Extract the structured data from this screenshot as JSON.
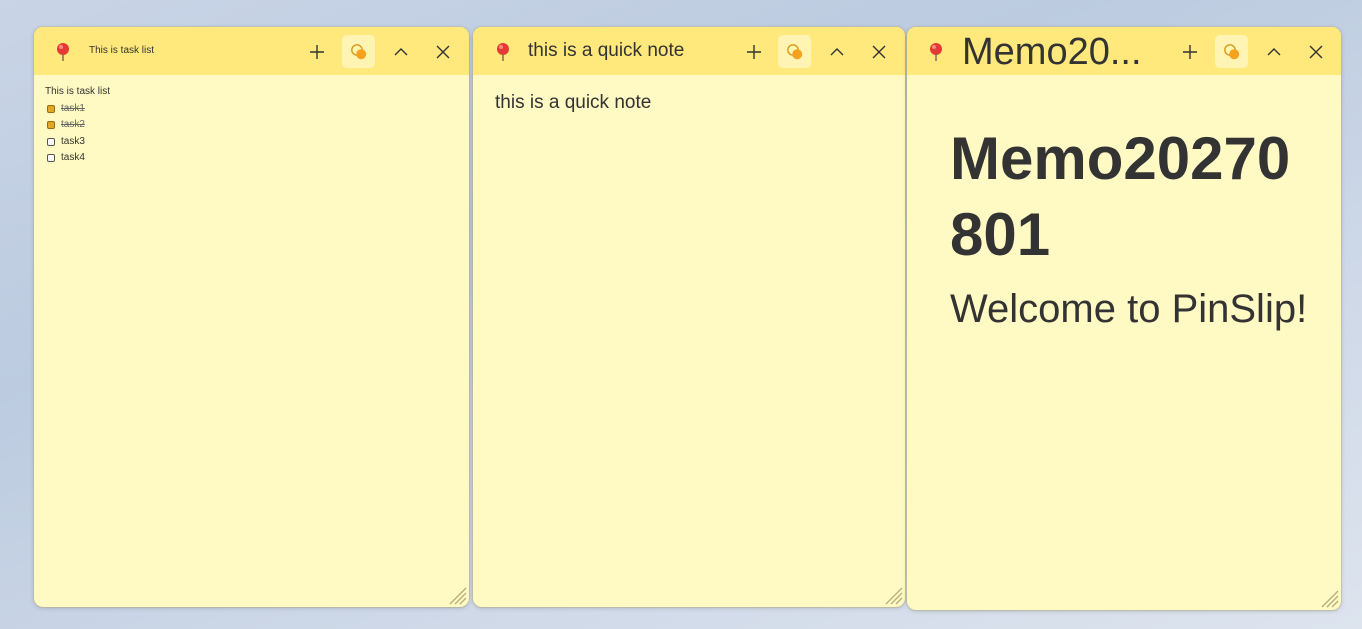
{
  "notes": [
    {
      "title": "This is task list",
      "heading": "This is task list",
      "tasks": [
        {
          "label": "task1",
          "done": true
        },
        {
          "label": "task2",
          "done": true
        },
        {
          "label": "task3",
          "done": false
        },
        {
          "label": "task4",
          "done": false
        }
      ]
    },
    {
      "title": "this is a quick note",
      "body": "this is a quick note"
    },
    {
      "title": "Memo20...",
      "heading": "Memo20270801",
      "body": "Welcome to PinSlip!"
    }
  ],
  "colors": {
    "header": "#ffe97c",
    "body": "#fff9c4",
    "color_button_bg": "#fff4b3",
    "pin": "#e53935",
    "checkbox_checked": "#e3a72a"
  },
  "icons": {
    "pin": "pushpin-icon",
    "add": "plus-icon",
    "color": "color-palette-icon",
    "collapse": "chevron-up-icon",
    "close": "close-icon",
    "resize": "resize-grip-icon"
  }
}
